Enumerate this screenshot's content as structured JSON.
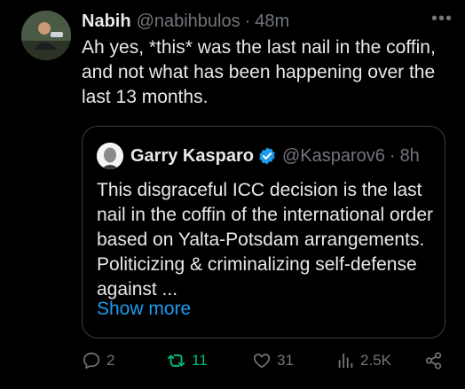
{
  "post": {
    "author_name": "Nabih",
    "handle": "@nabihbulos",
    "separator": "·",
    "time": "48m",
    "more": "•••",
    "text": "Ah yes, *this* was the last nail in the coffin, and not what has been happening over the last 13 months."
  },
  "quote": {
    "author_name": "Garry Kasparo",
    "handle": "@Kasparov6",
    "separator": "·",
    "time": "8h",
    "text": "This disgraceful ICC decision is the last nail in the coffin of the international order based on Yalta-Potsdam arrangements. Politicizing & criminalizing self-defense against ...",
    "show_more": "Show more"
  },
  "actions": {
    "replies": "2",
    "retweets": "11",
    "likes": "31",
    "views": "2.5K"
  },
  "colors": {
    "background": "#000000",
    "text": "#e7e9ea",
    "muted": "#71767b",
    "link": "#1d9bf0",
    "retweet": "#00ba7c",
    "verified": "#1d9bf0"
  }
}
